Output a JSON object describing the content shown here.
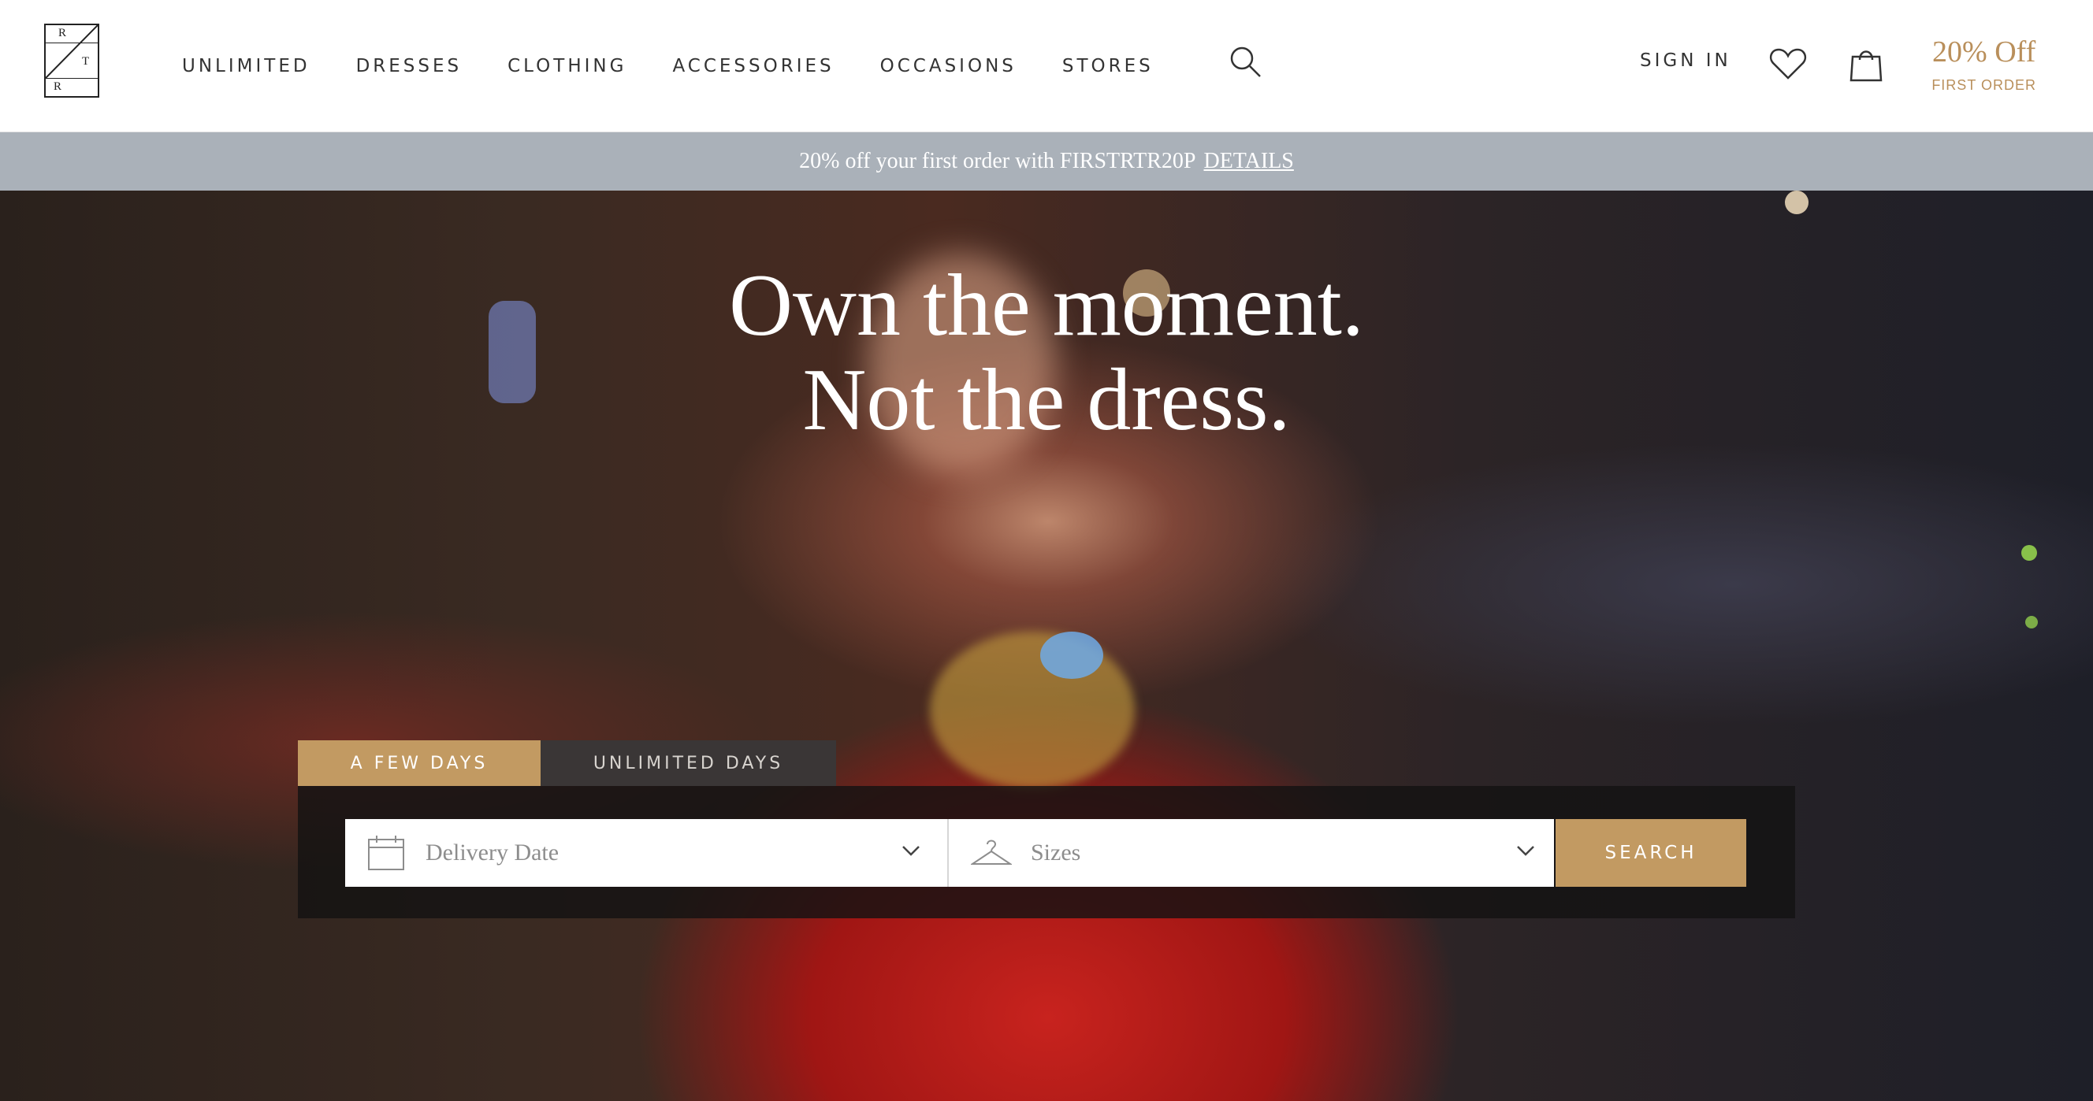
{
  "header": {
    "logo_letters": [
      "R",
      "T",
      "R"
    ],
    "nav": [
      {
        "label": "UNLIMITED"
      },
      {
        "label": "DRESSES"
      },
      {
        "label": "CLOTHING"
      },
      {
        "label": "ACCESSORIES"
      },
      {
        "label": "OCCASIONS"
      },
      {
        "label": "STORES"
      }
    ],
    "sign_in": "SIGN IN",
    "promo": {
      "title": "20% Off",
      "subtitle": "FIRST ORDER"
    },
    "icons": [
      "search-icon",
      "heart-icon",
      "shopping-bag-icon"
    ]
  },
  "banner": {
    "text": "20% off your first order with FIRSTRTR20P",
    "link": "DETAILS"
  },
  "hero": {
    "headline_line1": "Own the moment.",
    "headline_line2": "Not the dress."
  },
  "search": {
    "tabs": [
      {
        "label": "A FEW DAYS",
        "active": true
      },
      {
        "label": "UNLIMITED DAYS",
        "active": false
      }
    ],
    "delivery_placeholder": "Delivery Date",
    "sizes_placeholder": "Sizes",
    "button": "SEARCH",
    "icons": [
      "calendar-icon",
      "hanger-icon",
      "chevron-down-icon"
    ]
  },
  "colors": {
    "accent": "#c29a62",
    "banner": "#aab1b9",
    "promo_text": "#b98f5b"
  }
}
